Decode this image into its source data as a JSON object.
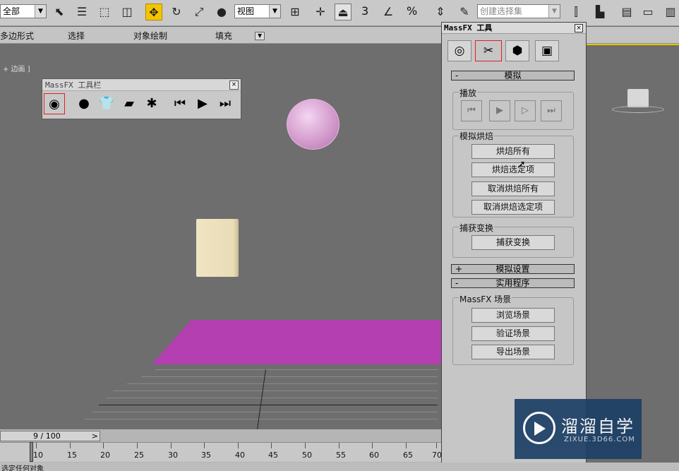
{
  "toolbar": {
    "selection_filter": "全部",
    "ref_coord": "视图",
    "named_selection_placeholder": "创建选择集",
    "snap_3": "3",
    "snap_percent": "%"
  },
  "ribbon": {
    "items": [
      "多边形式",
      "选择",
      "对象绘制",
      "填充"
    ]
  },
  "viewport": {
    "label": "+ 边画 ]"
  },
  "massfx_toolbar": {
    "title": "MassFX 工具栏"
  },
  "panel": {
    "title": "MassFX 工具",
    "rollout_sim": {
      "sign": "-",
      "label": "模拟"
    },
    "group_playback": "播放",
    "group_bake": "模拟烘焙",
    "bake_buttons": [
      "烘焙所有",
      "烘焙选定项",
      "取消烘焙所有",
      "取消烘焙选定项"
    ],
    "group_capture": "捕获变换",
    "capture_button": "捕获变换",
    "rollout_settings": {
      "sign": "+",
      "label": "模拟设置"
    },
    "rollout_utils": {
      "sign": "-",
      "label": "实用程序"
    },
    "group_scene": "MassFX 场景",
    "scene_buttons": [
      "浏览场景",
      "验证场景",
      "导出场景"
    ]
  },
  "timeline": {
    "frame_display": "9 / 100",
    "next_arrow": ">",
    "ticks": [
      "10",
      "15",
      "20",
      "25",
      "30",
      "35",
      "40",
      "45",
      "50",
      "55",
      "60",
      "65",
      "70"
    ]
  },
  "status": {
    "text": "选定任何对象"
  },
  "watermark": {
    "brand": "溜溜自学",
    "url": "ZIXUE.3D66.COM"
  }
}
